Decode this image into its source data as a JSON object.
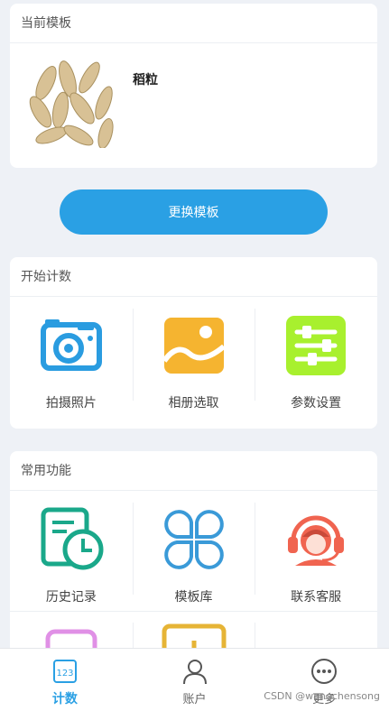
{
  "current_template": {
    "header": "当前模板",
    "name": "稻粒"
  },
  "change_button": "更换模板",
  "start_count": {
    "header": "开始计数",
    "items": [
      {
        "label": "拍摄照片",
        "icon": "camera-icon",
        "color": "#2a9ce0"
      },
      {
        "label": "相册选取",
        "icon": "gallery-icon",
        "color": "#f5b430"
      },
      {
        "label": "参数设置",
        "icon": "sliders-icon",
        "color": "#a8f02e"
      }
    ]
  },
  "common": {
    "header": "常用功能",
    "items": [
      {
        "label": "历史记录",
        "icon": "history-icon",
        "color": "#1aa88a"
      },
      {
        "label": "模板库",
        "icon": "template-library-icon",
        "color": "#3a9ad8"
      },
      {
        "label": "联系客服",
        "icon": "customer-service-icon",
        "color": "#f06450"
      }
    ]
  },
  "tabbar": {
    "tabs": [
      {
        "label": "计数",
        "icon": "counter-icon",
        "active": true
      },
      {
        "label": "账户",
        "icon": "user-icon",
        "active": false
      },
      {
        "label": "更多",
        "icon": "more-icon",
        "active": false
      }
    ]
  },
  "watermark": "CSDN @wangchensong"
}
